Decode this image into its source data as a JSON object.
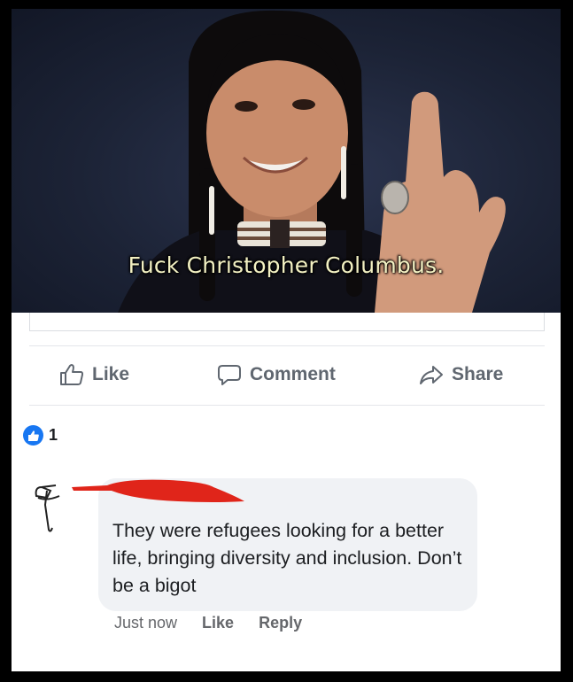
{
  "video": {
    "caption": "Fuck Christopher Columbus."
  },
  "post_actions": {
    "like": "Like",
    "comment": "Comment",
    "share": "Share"
  },
  "reactions": {
    "icon": "like-thumb-icon",
    "count": "1"
  },
  "comment": {
    "text": "They were refugees looking for a better life, bringing diversity and inclusion. Don’t be a bigot",
    "timestamp": "Just now",
    "like": "Like",
    "reply": "Reply"
  },
  "colors": {
    "like_blue": "#1877f2",
    "action_gray": "#606770",
    "bubble_bg": "#f0f2f5",
    "redaction_red": "#e0251a"
  }
}
